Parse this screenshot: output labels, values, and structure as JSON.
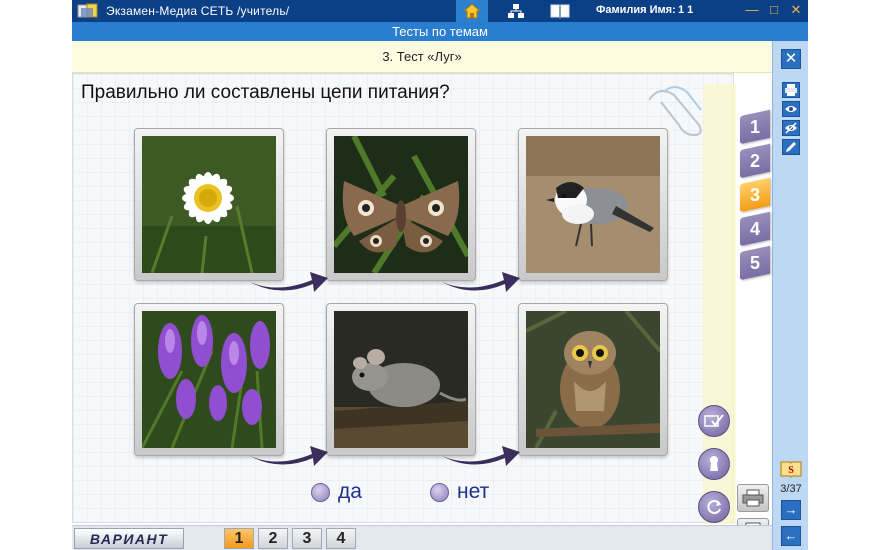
{
  "titlebar": {
    "app_title": "Экзамен-Медиа СЕТЬ /учитель/",
    "user_label": "Фамилия Имя:",
    "user_name": "1 1",
    "nav_icons": [
      "home-icon",
      "structure-icon",
      "book-icon"
    ]
  },
  "subbar": {
    "title": "Тесты по темам"
  },
  "test": {
    "title": "3. Тест «Луг»",
    "question": "Правильно ли составлены цепи питания?"
  },
  "question_tabs": [
    {
      "label": "1",
      "active": false
    },
    {
      "label": "2",
      "active": false
    },
    {
      "label": "3",
      "active": true
    },
    {
      "label": "4",
      "active": false
    },
    {
      "label": "5",
      "active": false
    }
  ],
  "food_chains": [
    [
      "daisy",
      "moth",
      "wagtail"
    ],
    [
      "vetch-flowers",
      "mouse",
      "owl"
    ]
  ],
  "answers": [
    {
      "label": "да"
    },
    {
      "label": "нет"
    }
  ],
  "right_panel": {
    "counter": "3/37",
    "tools": [
      "printer-icon",
      "eye-icon",
      "eye-crossed-icon",
      "pencil-icon"
    ]
  },
  "variant": {
    "label": "ВАРИАНТ",
    "tabs": [
      {
        "label": "1",
        "active": true
      },
      {
        "label": "2",
        "active": false
      },
      {
        "label": "3",
        "active": false
      },
      {
        "label": "4",
        "active": false
      }
    ]
  },
  "colors": {
    "title_bar": "#0b3f86",
    "sub_bar": "#2a7ecf",
    "accent_orange": "#f39c17",
    "tab_purple": "#7a6da4"
  }
}
